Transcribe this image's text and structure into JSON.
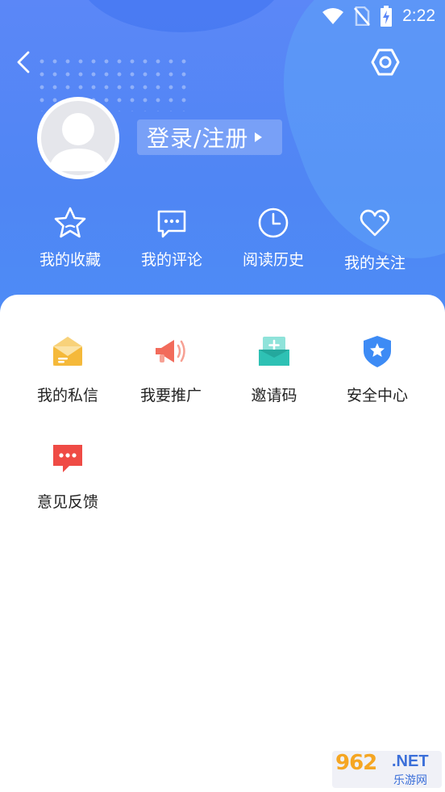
{
  "status_bar": {
    "time": "2:22"
  },
  "profile": {
    "login_label": "登录/注册"
  },
  "quick_actions": [
    {
      "label": "我的收藏",
      "icon": "star-icon"
    },
    {
      "label": "我的评论",
      "icon": "comment-icon"
    },
    {
      "label": "阅读历史",
      "icon": "clock-icon"
    },
    {
      "label": "我的关注",
      "icon": "heart-icon"
    }
  ],
  "menu": [
    {
      "label": "我的私信",
      "icon": "envelope-icon"
    },
    {
      "label": "我要推广",
      "icon": "megaphone-icon"
    },
    {
      "label": "邀请码",
      "icon": "invite-box-icon"
    },
    {
      "label": "安全中心",
      "icon": "shield-star-icon"
    },
    {
      "label": "意见反馈",
      "icon": "feedback-chat-icon"
    }
  ],
  "watermark": {
    "number": "962",
    "domain": ".NET",
    "name": "乐游网"
  },
  "colors": {
    "header_blue": "#4F86F4",
    "envelope": "#F5C242",
    "megaphone": "#F26B5B",
    "invite": "#2EC1B4",
    "shield": "#3D8BF5",
    "feedback": "#EF4B45"
  }
}
